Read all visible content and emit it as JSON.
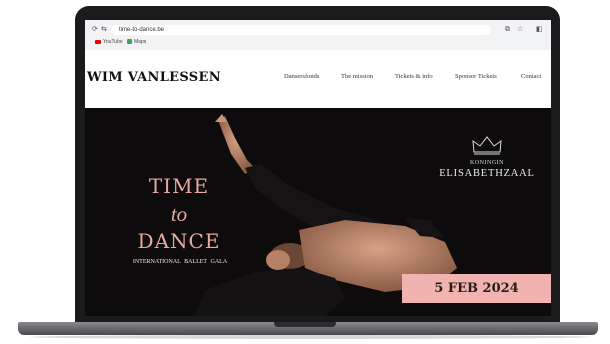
{
  "browser": {
    "url": "time-to-dance.be",
    "bookmarks": [
      "YouTube",
      "Maps"
    ]
  },
  "site": {
    "logo": "WIM VANLESSEN",
    "menu": [
      "Dansersfonds",
      "The mission",
      "Tickets & info",
      "Sponsor Tickets",
      "Contact"
    ]
  },
  "hero": {
    "title_line1": "TIME",
    "title_line2": "to",
    "title_line3": "DANCE",
    "subtitle": "INTERNATIONAL BALLET GALA",
    "venue_small": "KONINGIN",
    "venue_large": "ELISABETHZAAL",
    "date": "5 FEB 2024"
  },
  "colors": {
    "accent_pink": "#e8a9a2",
    "date_bg": "#f1b3b0",
    "hero_bg": "#0d0b0b"
  }
}
